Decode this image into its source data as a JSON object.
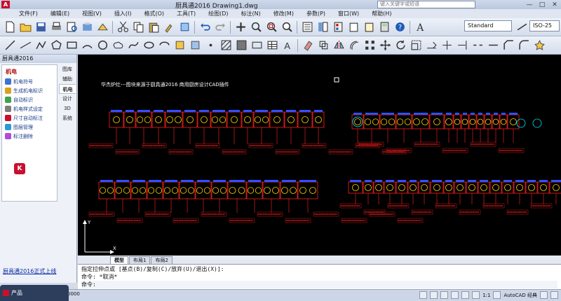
{
  "window": {
    "title": "厨具通2016    Drawing1.dwg",
    "search_placeholder": "键入关键字或短语",
    "min": "—",
    "max": "□",
    "close": "✕"
  },
  "menu": [
    "文件(F)",
    "编辑(E)",
    "视图(V)",
    "插入(I)",
    "格式(O)",
    "工具(T)",
    "绘图(D)",
    "标注(N)",
    "修改(M)",
    "参数(P)",
    "窗口(W)",
    "帮助(H)"
  ],
  "toolbar": {
    "text_style": "Standard",
    "dim_style": "ISO-25"
  },
  "left_panel": {
    "title": "厨具通2016",
    "category": "机电",
    "items": [
      "机电符号",
      "生成机电标识",
      "自动标识",
      "机电样式设定",
      "尺寸自动标注",
      "图层管理",
      "标注删除"
    ],
    "tabs": [
      "图库",
      "辅助",
      "机电",
      "设计",
      "3D",
      "系统"
    ],
    "active_tab": "机电",
    "link": "厨具通2016正式上线"
  },
  "drawing": {
    "caption": "华杰炉灶---图块来源于厨具通2016  商用厨房设计CAD插件",
    "crosshair_label_x": "X",
    "crosshair_label_y": "Y"
  },
  "layout_tabs": [
    "模型",
    "布局1",
    "布局2"
  ],
  "active_layout": "模型",
  "command": {
    "line1": "指定拉伸点或 [基点(B)/复制(C)/放弃(U)/退出(X)]:",
    "line2": "命令: *取消*",
    "prompt": "命令:"
  },
  "status": {
    "coords": "0000",
    "annotation_scale": "1:1",
    "workspace": "AutoCAD 经典"
  },
  "taskbar": {
    "label": "产品"
  },
  "colors": {
    "canvas_bg": "#000000",
    "cad_red": "#ff2020",
    "cad_blue": "#3050ff",
    "cad_yellow": "#ffd700",
    "cad_cyan": "#00e5ff"
  }
}
